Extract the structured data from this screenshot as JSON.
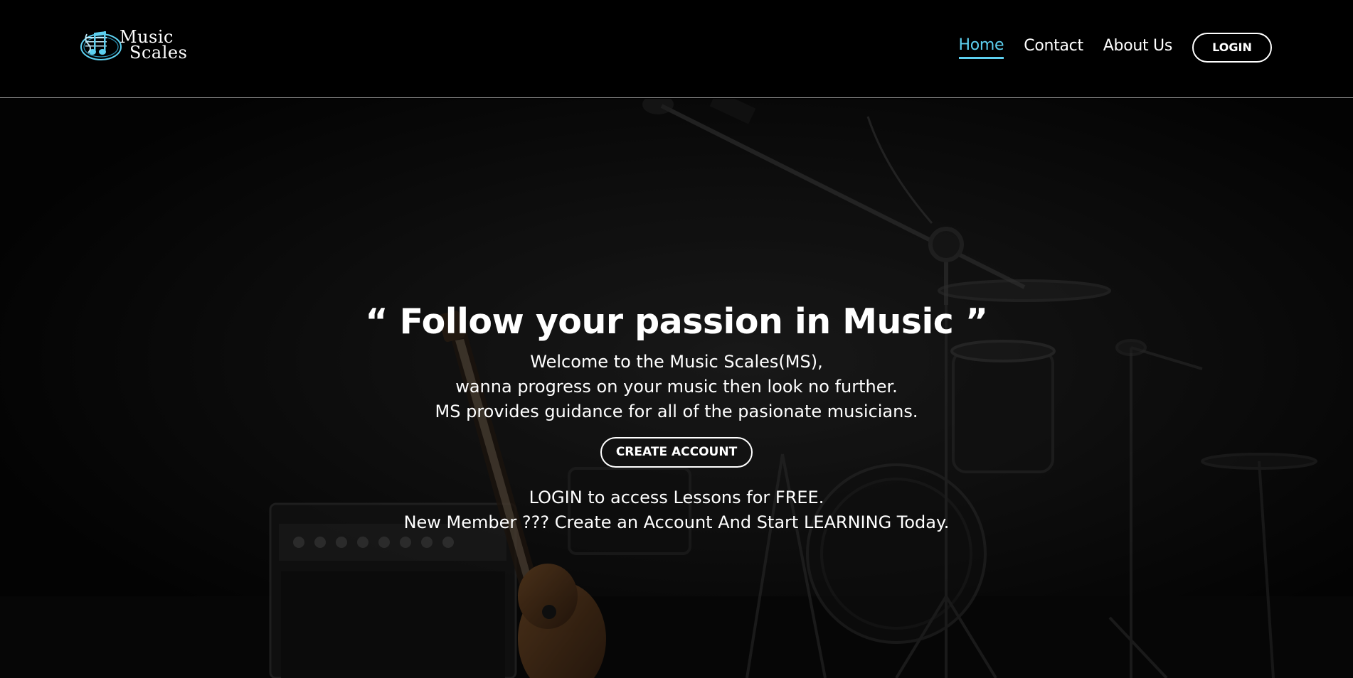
{
  "brand": {
    "line1": "Music",
    "line2": "Scales"
  },
  "nav": {
    "items": [
      {
        "label": "Home",
        "active": true
      },
      {
        "label": "Contact"
      },
      {
        "label": "About Us"
      }
    ],
    "login_label": "LOGIN"
  },
  "hero": {
    "headline": "“ Follow your passion in Music ”",
    "lines": [
      "Welcome to the Music Scales(MS),",
      "wanna progress on your music then look no further.",
      "MS provides guidance for all of the pasionate musicians."
    ],
    "create_account_label": "CREATE ACCOUNT",
    "notes": [
      "LOGIN to access Lessons for FREE.",
      "New Member ??? Create an Account And Start LEARNING Today."
    ]
  },
  "colors": {
    "accent": "#5dd0f0",
    "background": "#000000"
  }
}
